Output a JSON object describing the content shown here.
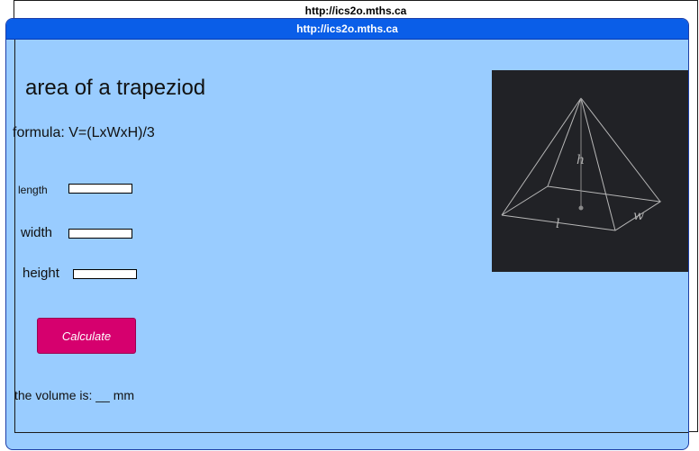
{
  "background_window": {
    "title": "http://ics2o.mths.ca"
  },
  "window": {
    "title": "http://ics2o.mths.ca"
  },
  "heading": "area of a trapeziod",
  "formula": "formula: V=(LxWxH)/3",
  "fields": {
    "length_label": "length",
    "width_label": "width",
    "height_label": "height",
    "length_value": "",
    "width_value": "",
    "height_value": ""
  },
  "calculate_label": "Calculate",
  "result_text": "the volume is: __ mm",
  "pyramid": {
    "height_letter": "h",
    "length_letter": "l",
    "width_letter": "w"
  },
  "colors": {
    "window_bg": "#99ccff",
    "titlebar": "#0a5ee8",
    "button": "#d6006e",
    "image_bg": "#212226"
  }
}
